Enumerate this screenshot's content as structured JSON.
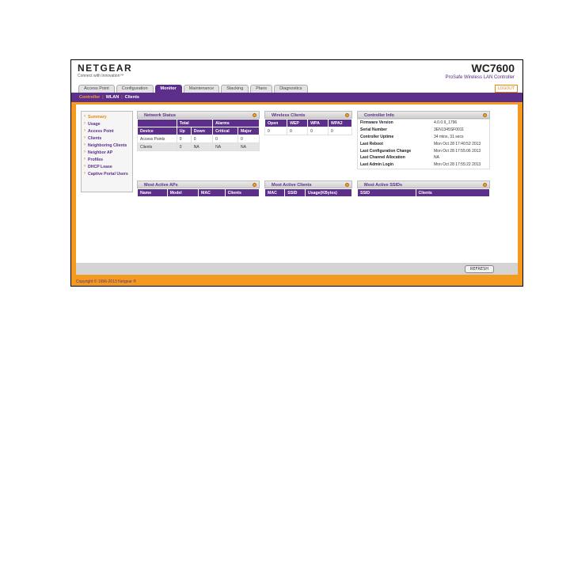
{
  "brand": {
    "logo": "NETGEAR",
    "tagline": "Connect with Innovation™",
    "model": "WC7600",
    "product": "ProSafe Wireless LAN Controller"
  },
  "tabs": [
    "Access Point",
    "Configuration",
    "Monitor",
    "Maintenance",
    "Stacking",
    "Plans",
    "Diagnostics"
  ],
  "active_tab": "Monitor",
  "logout_label": "LOGOUT",
  "subnav": {
    "controller": "Controller",
    "wlan": "WLAN",
    "clients": "Clients"
  },
  "sidebar": [
    "Summary",
    "Usage",
    "Access Point",
    "Clients",
    "Neighboring Clients",
    "Neighbor AP",
    "Profiles",
    "DHCP Lease",
    "Captive Portal Users"
  ],
  "network_status": {
    "title": "Network Status",
    "group_total": "Total",
    "group_alarms": "Alarms",
    "headers": [
      "Device",
      "Up",
      "Down",
      "Critical",
      "Major"
    ],
    "rows": [
      [
        "Access Points",
        "0",
        "0",
        "0",
        "0"
      ],
      [
        "Clients",
        "0",
        "NA",
        "NA",
        "NA"
      ]
    ]
  },
  "wireless_clients": {
    "title": "Wireless Clients",
    "headers": [
      "Open",
      "WEP",
      "WPA",
      "WPA2"
    ],
    "row": [
      "0",
      "0",
      "0",
      "0"
    ]
  },
  "controller_info": {
    "title": "Controller Info",
    "rows": [
      [
        "Firmware Version",
        "4.0.0.9_1796"
      ],
      [
        "Serial Number",
        "3EN1345SF0011"
      ],
      [
        "Controller Uptime",
        "34 mins, 31 secs"
      ],
      [
        "Last Reboot",
        "Mon Oct 28 17:40:52 2013"
      ],
      [
        "Last Configuration Change",
        "Mon Oct 28 17:55:06 2013"
      ],
      [
        "Last Channel Allocation",
        "NA"
      ],
      [
        "Last Admin Login",
        "Mon Oct 28 17:55:22 2013"
      ]
    ]
  },
  "most_active_aps": {
    "title": "Most Active APs",
    "headers": [
      "Name",
      "Model",
      "MAC",
      "Clients"
    ]
  },
  "most_active_clients": {
    "title": "Most Active Clients",
    "headers": [
      "MAC",
      "SSID",
      "Usage(KBytes)"
    ]
  },
  "most_active_ssids": {
    "title": "Most Active SSIDs",
    "headers": [
      "SSID",
      "Clients"
    ]
  },
  "refresh_label": "REFRESH",
  "footer": "Copyright © 1996-2013 Netgear ®",
  "colors": {
    "purple": "#5c2f8a",
    "orange": "#f39a1f"
  }
}
